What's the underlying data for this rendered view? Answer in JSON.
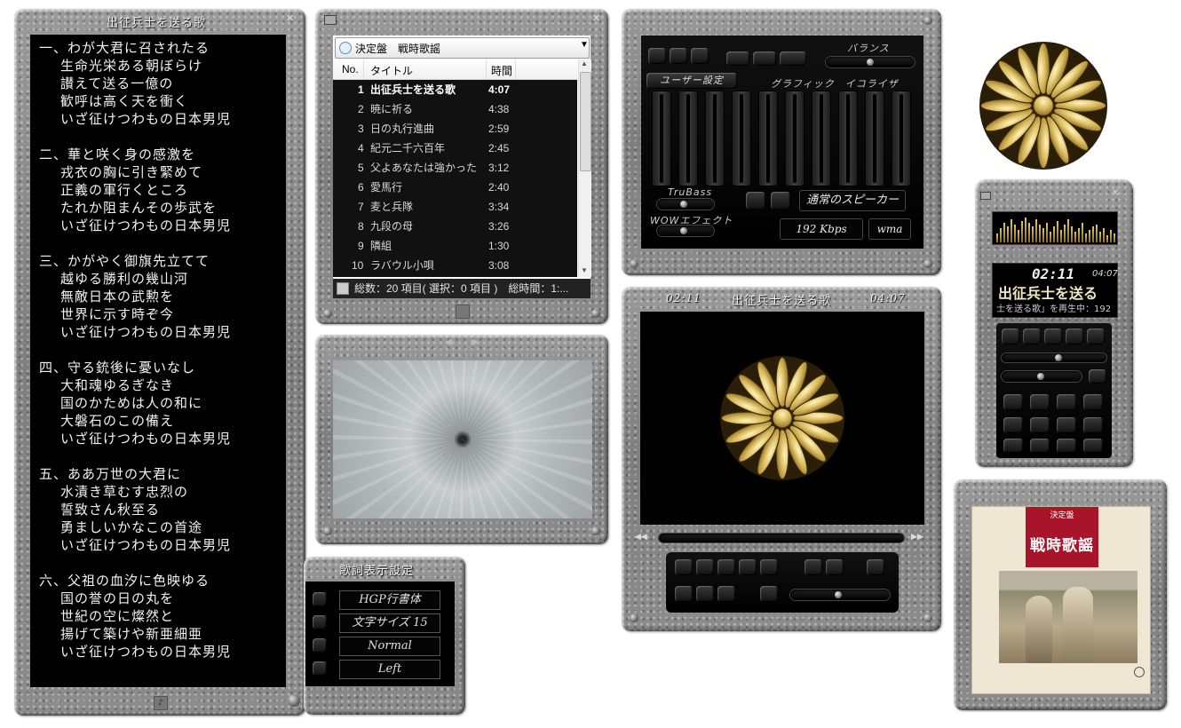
{
  "lyrics_window": {
    "title": "出征兵士を送る歌",
    "verses": [
      [
        "一、わが大君に召されたる",
        "生命光栄ある朝ぼらけ",
        "讃えて送る一億の",
        "歓呼は高く天を衝く",
        "いざ征けつわもの日本男児"
      ],
      [
        "二、華と咲く身の感激を",
        "戎衣の胸に引き緊めて",
        "正義の軍行くところ",
        "たれか阻まんその歩武を",
        "いざ征けつわもの日本男児"
      ],
      [
        "三、かがやく御旗先立てて",
        "越ゆる勝利の幾山河",
        "無敵日本の武勲を",
        "世界に示す時ぞ今",
        "いざ征けつわもの日本男児"
      ],
      [
        "四、守る銃後に憂いなし",
        "大和魂ゆるぎなき",
        "国のかためは人の和に",
        "大磐石のこの備え",
        "いざ征けつわもの日本男児"
      ],
      [
        "五、ああ万世の大君に",
        "水漬き草むす忠烈の",
        "誓致さん秋至る",
        "勇ましいかなこの首途",
        "いざ征けつわもの日本男児"
      ],
      [
        "六、父祖の血汐に色映ゆる",
        "国の誉の日の丸を",
        "世紀の空に燦然と",
        "揚げて築けや新亜細亜",
        "いざ征けつわもの日本男児"
      ]
    ]
  },
  "playlist": {
    "selected_list": "決定盤　戦時歌謡",
    "columns": {
      "no": "No.",
      "title": "タイトル",
      "time": "時間"
    },
    "tracks": [
      {
        "no": "1",
        "title": "出征兵士を送る歌",
        "time": "4:07"
      },
      {
        "no": "2",
        "title": "暁に祈る",
        "time": "4:38"
      },
      {
        "no": "3",
        "title": "日の丸行進曲",
        "time": "2:59"
      },
      {
        "no": "4",
        "title": "紀元二千六百年",
        "time": "2:45"
      },
      {
        "no": "5",
        "title": "父よあなたは強かった",
        "time": "3:12"
      },
      {
        "no": "6",
        "title": "愛馬行",
        "time": "2:40"
      },
      {
        "no": "7",
        "title": "麦と兵隊",
        "time": "3:34"
      },
      {
        "no": "8",
        "title": "九段の母",
        "time": "3:26"
      },
      {
        "no": "9",
        "title": "隣組",
        "time": "1:30"
      },
      {
        "no": "10",
        "title": "ラバウル小唄",
        "time": "3:08"
      }
    ],
    "status": "総数：20 項目( 選択：0 項目 )　総時間：1:..."
  },
  "lyric_settings": {
    "title": "歌詞表示設定",
    "font": "HGP行書体",
    "size": "文字サイズ 15",
    "style": "Normal",
    "align": "Left"
  },
  "equalizer": {
    "balance_label": "バランス",
    "preset_button": "ユーザー設定",
    "eq_label": "グラフィック　イコライザ",
    "trubass_label": "TruBass",
    "wow_label": "WOWエフェクト",
    "speaker": "通常のスピーカー",
    "bitrate": "192 Kbps",
    "format": "wma"
  },
  "video": {
    "elapsed": "02:11",
    "title": "出征兵士を送る歌",
    "total": "04:07"
  },
  "mini_player": {
    "elapsed": "02:11",
    "total": "04:07",
    "title": "出征兵士を送る",
    "scroll": "士を送る歌」を再生中：192"
  },
  "album_art": {
    "label_top": "決定盤",
    "title": "戦時歌謡"
  },
  "colors": {
    "stone": "#8a8a8a",
    "gold": "#c8a84a",
    "album_red": "#a8142a"
  }
}
